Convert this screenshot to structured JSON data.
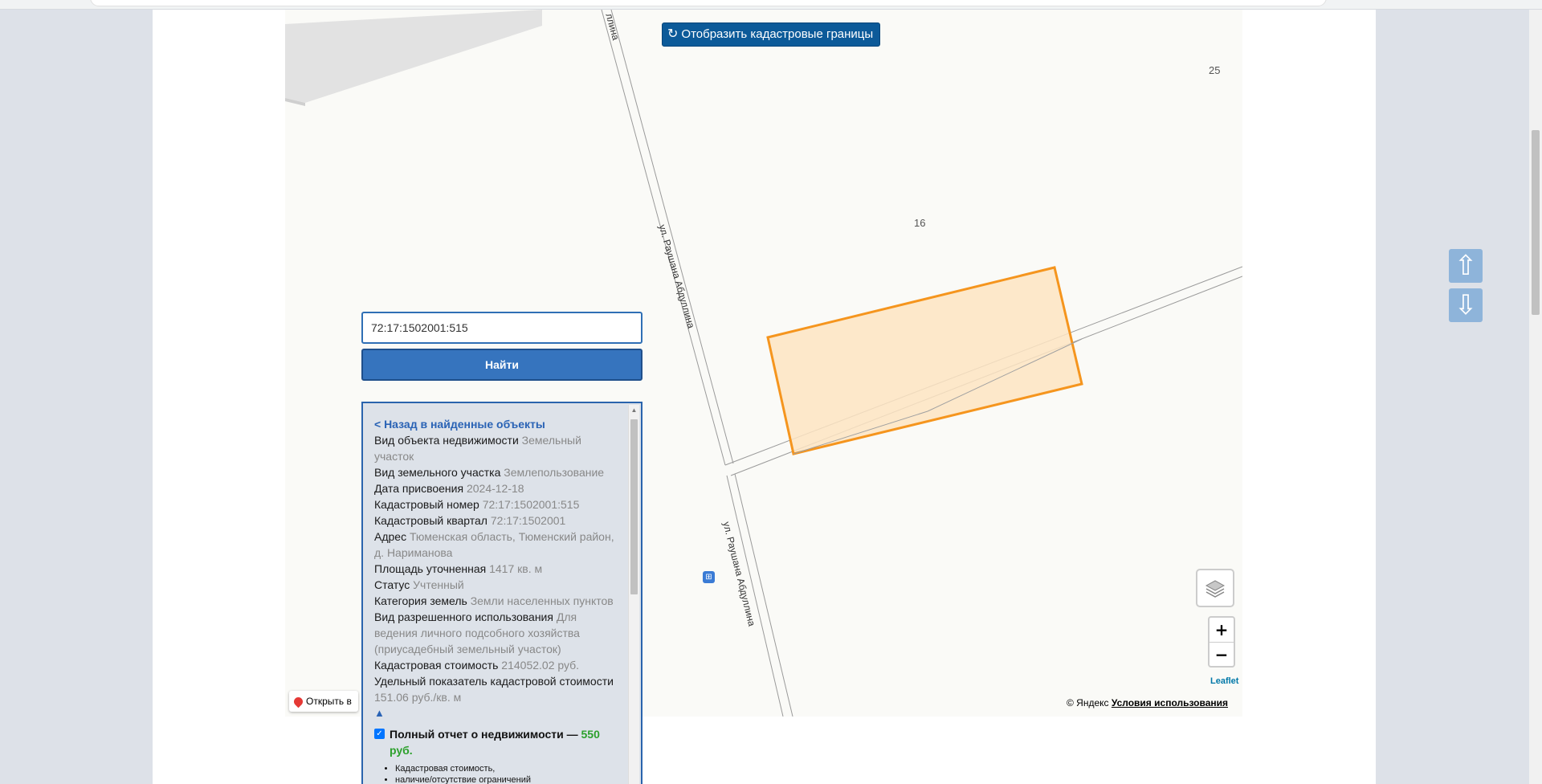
{
  "map": {
    "cadastral_button_label": "Отобразить кадастровые границы",
    "cadastral_button_icon": "refresh-icon",
    "house_numbers": [
      "25",
      "16"
    ],
    "street_label": "ул. Раушана Абдуллина",
    "street_label_partial": "ллина",
    "bus_stop_icon": "bus-stop-icon",
    "layers_icon": "layers-icon",
    "zoom_in_label": "+",
    "zoom_out_label": "−",
    "leaflet_label": "Leaflet",
    "attribution_prefix": "© Яндекс",
    "attribution_link": "Условия использования",
    "open_in_label": "Открыть в",
    "parcel_fill": "#fde4c2",
    "parcel_stroke": "#f5951e"
  },
  "search": {
    "value": "72:17:1502001:515",
    "find_label": "Найти"
  },
  "panel": {
    "back_label": "< Назад в найденные объекты",
    "rows": [
      {
        "key": "Вид объекта недвижимости",
        "value": "Земельный участок"
      },
      {
        "key": "Вид земельного участка",
        "value": "Землепользование"
      },
      {
        "key": "Дата присвоения",
        "value": "2024-12-18"
      },
      {
        "key": "Кадастровый номер",
        "value": "72:17:1502001:515"
      },
      {
        "key": "Кадастровый квартал",
        "value": "72:17:1502001"
      },
      {
        "key": "Адрес",
        "value": "Тюменская область, Тюменский район, д. Нариманова"
      },
      {
        "key": "Площадь уточненная",
        "value": "1417 кв. м"
      },
      {
        "key": "Статус",
        "value": "Учтенный"
      },
      {
        "key": "Категория земель",
        "value": "Земли населенных пунктов"
      },
      {
        "key": "Вид разрешенного использования",
        "value": "Для ведения личного подсобного хозяйства (приусадебный земельный участок)"
      },
      {
        "key": "Кадастровая стоимость",
        "value": "214052.02 руб."
      },
      {
        "key": "Удельный показатель кадастровой стоимости",
        "value": "151.06 руб./кв. м"
      }
    ],
    "collapse_label": "▲",
    "report_label": "Полный отчет о недвижимости —",
    "report_price": "550 руб.",
    "bullets": [
      "Кадастровая стоимость,",
      "наличие/отсутствие ограничений"
    ]
  },
  "nav": {
    "up_label": "⇧",
    "down_label": "⇩"
  }
}
